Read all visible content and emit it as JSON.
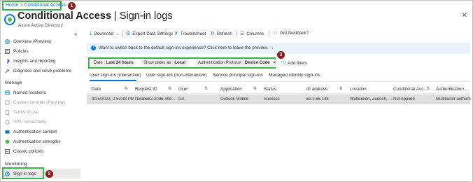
{
  "breadcrumb": {
    "home": "Home",
    "separator": ">",
    "current": "Conditional Access"
  },
  "callouts": [
    "1",
    "2",
    "3"
  ],
  "header": {
    "title_bold": "Conditional Access",
    "title_rest": " | Sign-in logs",
    "subtitle": "Azure Active Directory",
    "pin": "⚲",
    "more": "···",
    "close": "✕"
  },
  "sidebar": {
    "collapse": "«",
    "top_items": [
      {
        "label": "Overview (Preview)",
        "icon": "overview-icon"
      },
      {
        "label": "Policies",
        "icon": "policies-icon"
      },
      {
        "label": "Insights and reporting",
        "icon": "insights-icon"
      },
      {
        "label": "Diagnose and solve problems",
        "icon": "diagnose-icon"
      }
    ],
    "manage_label": "Manage",
    "manage_items": [
      {
        "label": "Named locations",
        "disabled": false
      },
      {
        "label": "Custom controls (Preview)",
        "disabled": true
      },
      {
        "label": "Terms of use",
        "disabled": true
      },
      {
        "label": "VPN connectivity",
        "disabled": true
      },
      {
        "label": "Authentication context",
        "disabled": false
      },
      {
        "label": "Authentication strengths",
        "disabled": false
      },
      {
        "label": "Classic policies",
        "disabled": false
      }
    ],
    "monitoring_label": "Monitoring",
    "monitoring_items": [
      {
        "label": "Sign-in logs",
        "selected": true
      }
    ]
  },
  "toolbar": {
    "download": "Download",
    "export": "Export Data Settings",
    "troubleshoot": "Troubleshoot",
    "refresh": "Refresh",
    "columns": "Columns",
    "feedback": "Got feedback?"
  },
  "infobar": {
    "text": "Want to switch back to the default sign-ins experience? Click here to leave the preview. →"
  },
  "filters": {
    "date_prefix": "Date : ",
    "date_value": "Last 24 hours",
    "show_dates_prefix": "Show dates as : ",
    "show_dates_value": "Local",
    "auth_prefix": "Authentication Protocol : ",
    "auth_value": "Device Code",
    "add_filters": "Add filters"
  },
  "tabs": [
    "User sign-ins (interactive)",
    "User sign-ins (non-interactive)",
    "Service principal sign-ins",
    "Managed identity sign-ins"
  ],
  "table": {
    "columns": [
      "Date",
      "Request ID",
      "User",
      "Application",
      "Status",
      "IP address",
      "Location",
      "Conditional Acc...",
      "Authentication ..."
    ],
    "rows": [
      [
        "4/25/2023, 2:53:48 PM",
        "f18ab682-20d6-49d...",
        "GA",
        "Outlook Mobile",
        "Success",
        "62.2.85.148",
        "Wallisellen, Zuerich, ...",
        "Not Applied",
        "Multifactor authenti..."
      ]
    ]
  },
  "colors": {
    "accent": "#0078d4",
    "highlight": "#39b54a",
    "badge": "#8b1a1a"
  }
}
